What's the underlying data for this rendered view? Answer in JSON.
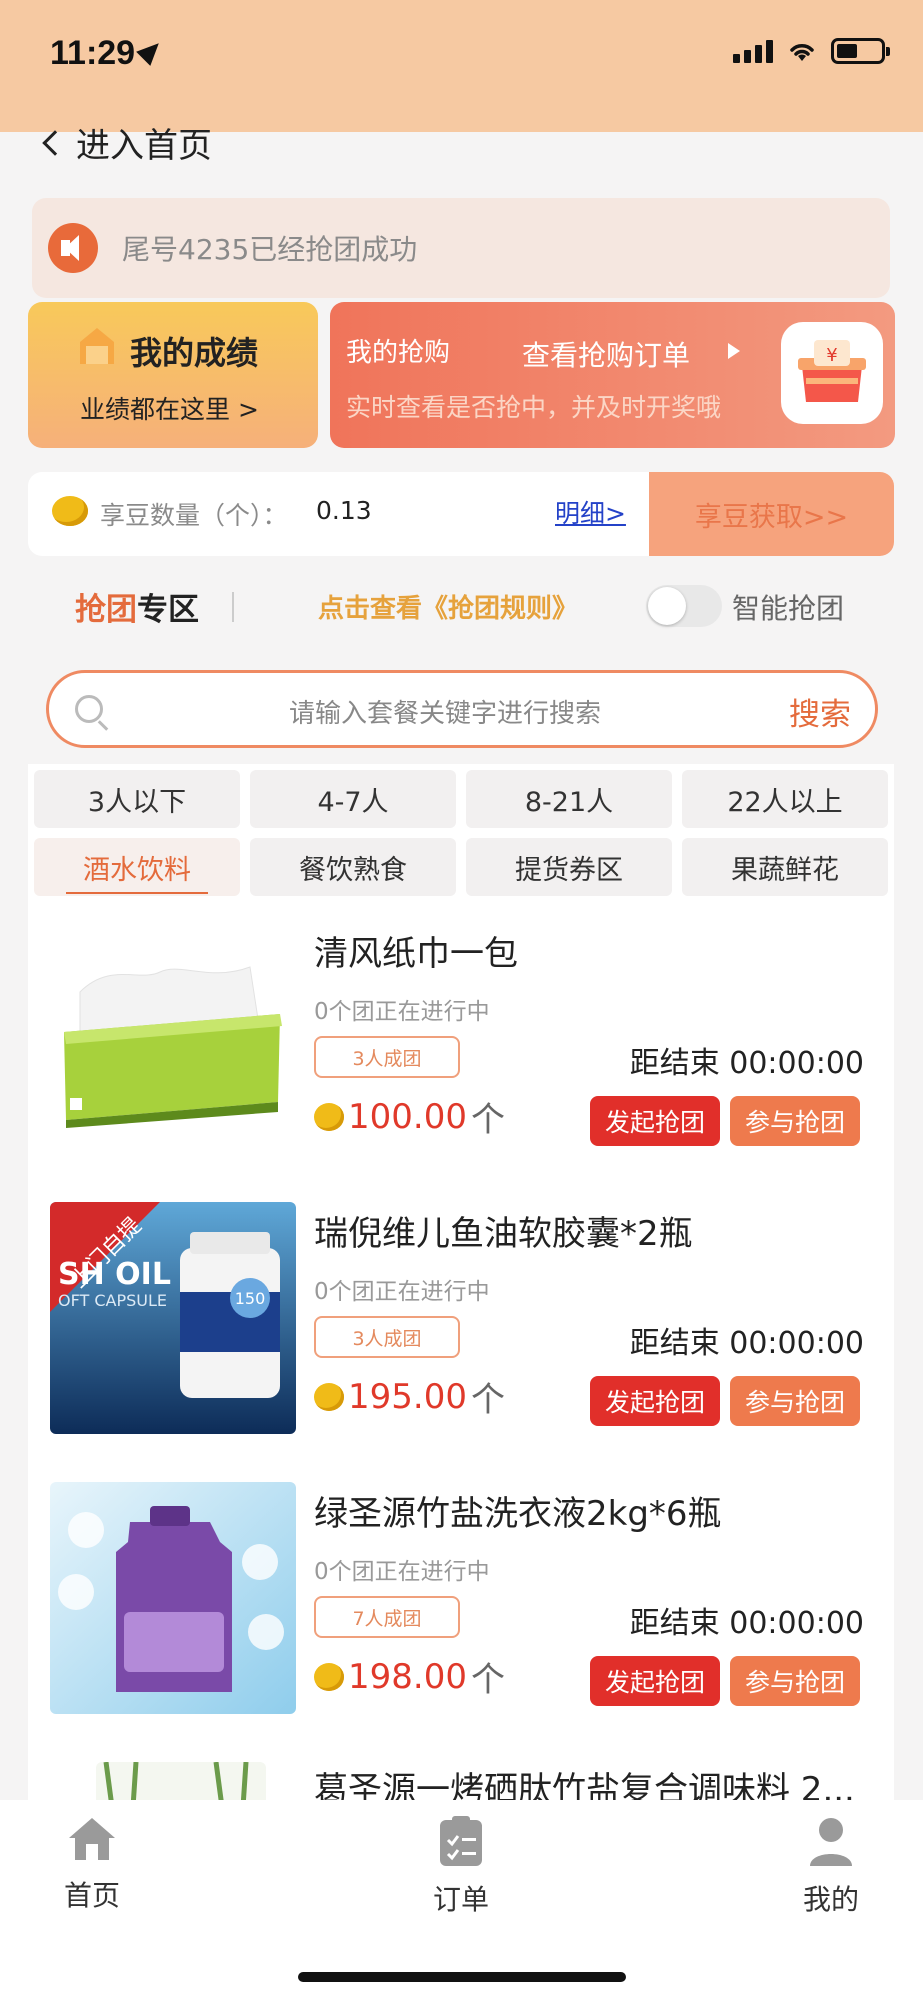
{
  "status_bar": {
    "time": "11:29"
  },
  "nav": {
    "back_label": "进入首页"
  },
  "notice": {
    "text": "尾号4235已经抢团成功"
  },
  "score_card": {
    "title": "我的成绩",
    "subtitle": "业绩都在这里 >"
  },
  "buy_card": {
    "title": "我的抢购",
    "orders_link": "查看抢购订单",
    "subtitle": "实时查看是否抢中，并及时开奖哦"
  },
  "beans": {
    "label": "享豆数量（个）：",
    "value": "0.13",
    "detail_link": "明细>",
    "get_button": "享豆获取>>"
  },
  "zone": {
    "title_accent": "抢团",
    "title_rest": "专区",
    "rules_link": "点击查看《抢团规则》",
    "smart_label": "智能抢团",
    "smart_enabled": false
  },
  "search": {
    "placeholder": "请输入套餐关键字进行搜索",
    "button": "搜索"
  },
  "filters": {
    "group_size": [
      "3人以下",
      "4-7人",
      "8-21人",
      "22人以上"
    ],
    "category": [
      "酒水饮料",
      "餐饮熟食",
      "提货券区",
      "果蔬鲜花"
    ],
    "active_category": "酒水饮料"
  },
  "products": [
    {
      "name": "清风纸巾一包",
      "status": "0个团正在进行中",
      "badge": "3人成团",
      "countdown": "距结束  00:00:00",
      "price": "100.00",
      "unit": "个",
      "start_label": "发起抢团",
      "join_label": "参与抢团"
    },
    {
      "name": "瑞倪维儿鱼油软胶囊*2瓶",
      "status": "0个团正在进行中",
      "badge": "3人成团",
      "countdown": "距结束  00:00:00",
      "price": "195.00",
      "unit": "个",
      "start_label": "发起抢团",
      "join_label": "参与抢团",
      "image_ribbon": "上门自提",
      "image_text_1": "SH OIL",
      "image_text_2": "OFT CAPSULE",
      "image_badge": "150"
    },
    {
      "name": "绿圣源竹盐洗衣液2kg*6瓶",
      "status": "0个团正在进行中",
      "badge": "7人成团",
      "countdown": "距结束  00:00:00",
      "price": "198.00",
      "unit": "个",
      "start_label": "发起抢团",
      "join_label": "参与抢团"
    },
    {
      "name": "葛圣源一烤硒肽竹盐复合调味料 2..."
    }
  ],
  "tabbar": {
    "home": "首页",
    "orders": "订单",
    "mine": "我的"
  },
  "colors": {
    "header_bg": "#f6c9a2",
    "accent": "#e46b3c",
    "price": "#e0392a",
    "start_button": "#e12f2a",
    "join_button": "#ee7a4d"
  }
}
